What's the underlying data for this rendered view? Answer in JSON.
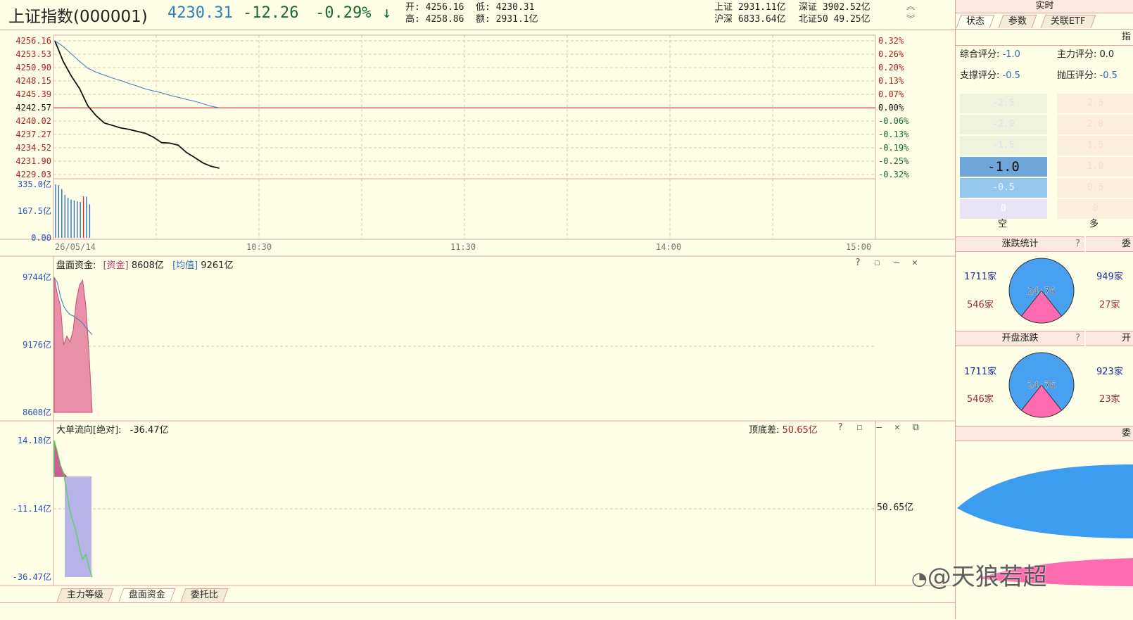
{
  "header": {
    "index_name": "上证指数(000001)",
    "price": "4230.31",
    "change": "-12.26",
    "change_pct": "-0.29%",
    "arrow": "↓",
    "open_label": "开:",
    "open": "4256.16",
    "low_label": "低:",
    "low": "4230.31",
    "high_label": "高:",
    "high": "4258.86",
    "amount_label": "额:",
    "amount": "2931.1亿",
    "sh_label": "上证",
    "sh": "2931.11亿",
    "sz_label": "深证",
    "sz": "3902.52亿",
    "hs_label": "沪深",
    "hs": "6833.64亿",
    "bz_label": "北证50",
    "bz": "49.25亿"
  },
  "price_chart": {
    "left_ticks": [
      "4256.16",
      "4253.53",
      "4250.90",
      "4248.15",
      "4245.39",
      "4242.57",
      "4240.02",
      "4237.27",
      "4234.52",
      "4231.90",
      "4229.03"
    ],
    "right_ticks": [
      "0.32%",
      "0.26%",
      "0.20%",
      "0.13%",
      "0.07%",
      "0.00%",
      "-0.06%",
      "-0.13%",
      "-0.19%",
      "-0.25%",
      "-0.32%"
    ],
    "vol_ticks": [
      "335.0亿",
      "167.5亿",
      "0.00"
    ],
    "time_ticks": [
      "26/05/14",
      "10:30",
      "11:30",
      "14:00",
      "15:00"
    ]
  },
  "chart_data": [
    {
      "type": "line",
      "title": "",
      "x": [
        0,
        1,
        2,
        3,
        4,
        5,
        6,
        7,
        8,
        9,
        10,
        11,
        12,
        13,
        14,
        15,
        16,
        17,
        18,
        19,
        20
      ],
      "series": [
        {
          "values": [
            4256.16,
            4252.0,
            4249.0,
            4246.5,
            4243.0,
            4241.0,
            4239.5,
            4239.0,
            4238.5,
            4238.2,
            4237.8,
            4237.4,
            4236.6,
            4235.5,
            4235.4,
            4235.0,
            4233.5,
            4232.5,
            4231.4,
            4230.7,
            4230.31
          ]
        },
        {
          "values": [
            4256.16,
            4255.0,
            4253.5,
            4252.0,
            4250.6,
            4249.8,
            4249.2,
            4248.6,
            4248.1,
            4247.5,
            4247.0,
            4246.4,
            4246.0,
            4245.6,
            4245.1,
            4244.7,
            4244.3,
            4243.9,
            4243.4,
            4242.9,
            4242.57
          ]
        }
      ],
      "ylim": [
        4229.03,
        4256.16
      ],
      "prev_close": 4242.57
    },
    {
      "type": "bar",
      "title": "",
      "values": [
        335,
        330,
        305,
        270,
        250,
        240,
        235,
        230,
        225,
        260,
        258,
        210
      ],
      "ylim": [
        0,
        335
      ]
    },
    {
      "type": "area",
      "title": "盘面资金",
      "series": [
        {
          "name": "资金",
          "values": [
            9744,
            9600,
            9500,
            9176,
            9250,
            9200,
            9300,
            9550,
            9680,
            9720,
            9500,
            9100,
            8608
          ]
        },
        {
          "name": "均值",
          "values": [
            9744,
            9700,
            9580,
            9500,
            9460,
            9430,
            9420,
            9400,
            9380,
            9360,
            9320,
            9290,
            9261
          ]
        }
      ],
      "ylim": [
        8608,
        9744
      ]
    },
    {
      "type": "area",
      "title": "大单流向[绝对]",
      "values": [
        14.18,
        10.0,
        5.0,
        2.0,
        -5.0,
        -12.0,
        -16.0,
        -20.0,
        -26.0,
        -30.0,
        -28.0,
        -33.0,
        -36.47
      ],
      "ylim": [
        -36.47,
        14.18
      ]
    }
  ],
  "pane2": {
    "title": "盘面资金:",
    "fund_label": "[资金]",
    "fund_value": "8608亿",
    "avg_label": "[均值]",
    "avg_value": "9261亿",
    "ticks": [
      "9744亿",
      "9176亿",
      "8608亿"
    ]
  },
  "pane3": {
    "title": "大单流向[绝对]:",
    "value": "-36.47亿",
    "diff_label": "顶底差:",
    "diff_value": "50.65亿",
    "right_value": "50.65亿",
    "ticks": [
      "14.18亿",
      "-11.14亿",
      "-36.47亿"
    ]
  },
  "bottom_tabs": [
    "主力等级",
    "盘面资金",
    "委托比"
  ],
  "right_panel": {
    "title": "实时",
    "tabs": [
      "状态",
      "参数",
      "关联ETF"
    ],
    "score_total_label": "综合评分:",
    "score_total": "-1.0",
    "score_main_label": "主力评分:",
    "score_main": "0.0",
    "support_label": "支撑评分:",
    "support": "-0.5",
    "pressure_label": "抛压评分:",
    "pressure": "-0.5",
    "bars_left": [
      "-2.5",
      "-2.0",
      "-1.5",
      "-1.0",
      "-0.5",
      "0"
    ],
    "bars_right": [
      "2.5",
      "2.0",
      "1.5",
      "1.0",
      "0.5",
      "0"
    ],
    "kong": "空",
    "duo": "多",
    "rise_stats_title": "涨跌统计",
    "rise_count": "1711家",
    "fall_count": "546家",
    "ratio": "24:76",
    "side_rise": "949家",
    "side_fall": "27家",
    "open_stats_title": "开盘涨跌",
    "open_rise": "1711家",
    "open_fall": "546家",
    "open_ratio": "24:76",
    "side_open_rise": "923家",
    "side_open_fall": "23家",
    "side_head1": "委",
    "side_head2": "开",
    "side_head3": "委",
    "side_head_top": "指",
    "help": "?"
  },
  "watermark": "@天狼若超"
}
